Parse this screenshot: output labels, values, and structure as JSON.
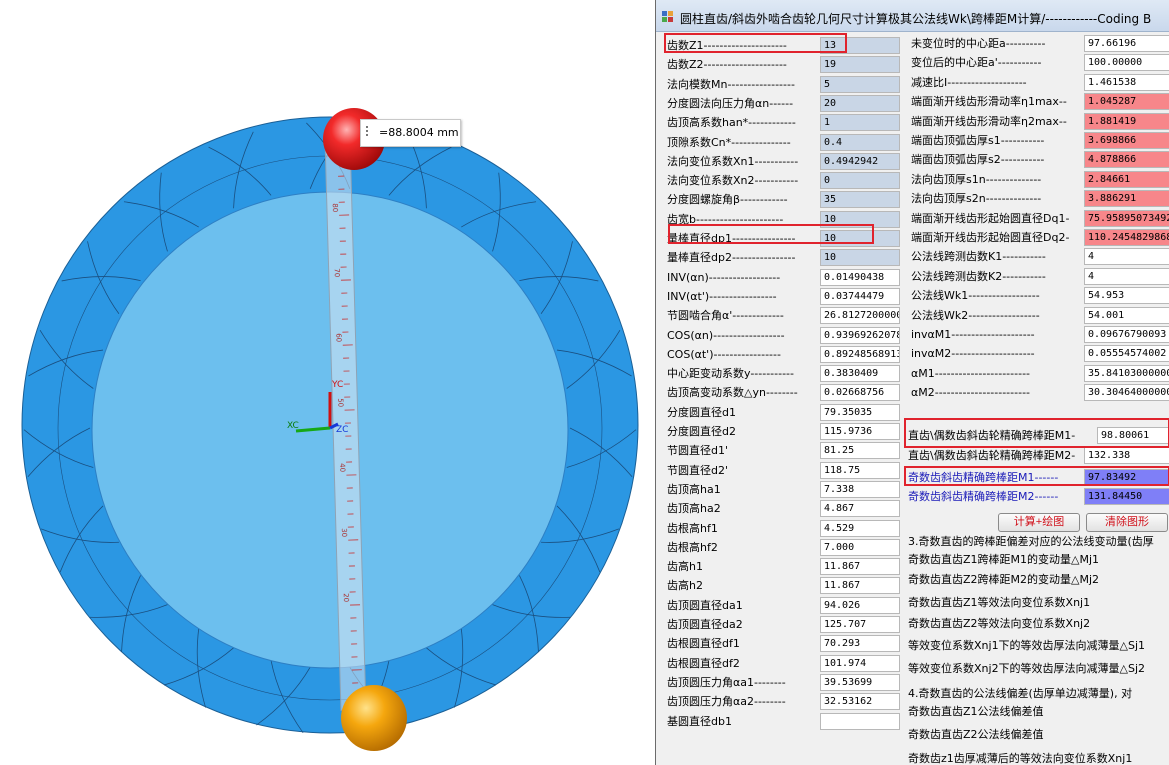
{
  "window": {
    "title": "圆柱直齿/斜齿外啮合齿轮几何尺寸计算极其公法线Wk\\跨棒距M计算/------------Coding B"
  },
  "viewport": {
    "measurement": "=88.8004 mm",
    "ruler_ticks": [
      "80",
      "70",
      "60",
      "50",
      "40",
      "30",
      "20"
    ],
    "axes": {
      "yc": "YC",
      "xc": "XC",
      "zc": "ZC"
    },
    "colors": {
      "gear_outer": "#2d9be7",
      "gear_inner": "#6cc0ee",
      "ball_top": "#e51b1b",
      "ball_bottom": "#f2a50c"
    }
  },
  "left_rows": [
    {
      "label": "齿数Z1---------------------",
      "value": "13",
      "kind": "in"
    },
    {
      "label": "齿数Z2---------------------",
      "value": "19",
      "kind": "in"
    },
    {
      "label": "法向模数Mn-----------------",
      "value": "5",
      "kind": "in"
    },
    {
      "label": "分度圆法向压力角αn------",
      "value": "20",
      "kind": "in"
    },
    {
      "label": "齿顶高系数han*------------",
      "value": "1",
      "kind": "in"
    },
    {
      "label": "顶隙系数Cn*---------------",
      "value": "0.4",
      "kind": "in"
    },
    {
      "label": "法向变位系数Xn1-----------",
      "value": "0.4942942",
      "kind": "in"
    },
    {
      "label": "法向变位系数Xn2-----------",
      "value": "0",
      "kind": "in"
    },
    {
      "label": "分度圆螺旋角β------------",
      "value": "35",
      "kind": "in"
    },
    {
      "label": "齿宽b----------------------",
      "value": "10",
      "kind": "in"
    },
    {
      "label": "量棒直径dp1----------------",
      "value": "10",
      "kind": "in"
    },
    {
      "label": "量棒直径dp2----------------",
      "value": "10",
      "kind": "in"
    },
    {
      "label": "INV(αn)------------------",
      "value": "0.01490438",
      "kind": "out"
    },
    {
      "label": "INV(αt')-----------------",
      "value": "0.03744479",
      "kind": "out"
    },
    {
      "label": "节圆啮合角α'-------------",
      "value": "26.81272000000",
      "kind": "out"
    },
    {
      "label": "COS(αn)------------------",
      "value": "0.93969262078",
      "kind": "out"
    },
    {
      "label": "COS(αt')-----------------",
      "value": "0.89248568913",
      "kind": "out"
    },
    {
      "label": "中心距变动系数y-----------",
      "value": "0.3830409",
      "kind": "out"
    },
    {
      "label": "齿顶高变动系数△yn--------",
      "value": "0.02668756",
      "kind": "out"
    },
    {
      "label": "分度圆直径d1",
      "value": "79.35035",
      "kind": "out"
    },
    {
      "label": "分度圆直径d2",
      "value": "115.9736",
      "kind": "out"
    },
    {
      "label": "节圆直径d1'",
      "value": "81.25",
      "kind": "out"
    },
    {
      "label": "节圆直径d2'",
      "value": "118.75",
      "kind": "out"
    },
    {
      "label": "齿顶高ha1",
      "value": "7.338",
      "kind": "out"
    },
    {
      "label": "齿顶高ha2",
      "value": "4.867",
      "kind": "out"
    },
    {
      "label": "齿根高hf1",
      "value": "4.529",
      "kind": "out"
    },
    {
      "label": "齿根高hf2",
      "value": "7.000",
      "kind": "out"
    },
    {
      "label": "齿高h1",
      "value": "11.867",
      "kind": "out"
    },
    {
      "label": "齿高h2",
      "value": "11.867",
      "kind": "out"
    },
    {
      "label": "齿顶圆直径da1",
      "value": "94.026",
      "kind": "out"
    },
    {
      "label": "齿顶圆直径da2",
      "value": "125.707",
      "kind": "out"
    },
    {
      "label": "齿根圆直径df1",
      "value": "70.293",
      "kind": "out"
    },
    {
      "label": "齿根圆直径df2",
      "value": "101.974",
      "kind": "out"
    },
    {
      "label": "齿顶圆压力角αa1--------",
      "value": "39.53699",
      "kind": "out"
    },
    {
      "label": "齿顶圆压力角αa2--------",
      "value": "32.53162",
      "kind": "out"
    },
    {
      "label": "基圆直径db1",
      "value": "",
      "kind": "out"
    }
  ],
  "right_rows": [
    {
      "label": "未变位时的中心距a----------",
      "value": "97.66196",
      "kind": "out"
    },
    {
      "label": "变位后的中心距a'-----------",
      "value": "100.00000",
      "kind": "out"
    },
    {
      "label": "减速比I--------------------",
      "value": "1.461538",
      "kind": "out"
    },
    {
      "label": "端面渐开线齿形滑动率η1max--",
      "value": "1.045287",
      "kind": "red"
    },
    {
      "label": "端面渐开线齿形滑动率η2max--",
      "value": "1.881419",
      "kind": "red"
    },
    {
      "label": "端面齿顶弧齿厚s1-----------",
      "value": "3.698866",
      "kind": "red"
    },
    {
      "label": "端面齿顶弧齿厚s2-----------",
      "value": "4.878866",
      "kind": "red"
    },
    {
      "label": "法向齿顶厚s1n--------------",
      "value": "2.84661",
      "kind": "red"
    },
    {
      "label": "法向齿顶厚s2n--------------",
      "value": "3.886291",
      "kind": "red"
    },
    {
      "label": "端面渐开线齿形起始圆直径Dq1-",
      "value": "75.95895073492",
      "kind": "red"
    },
    {
      "label": "端面渐开线齿形起始圆直径Dq2-",
      "value": "110.2454829868",
      "kind": "red"
    },
    {
      "label": "公法线跨测齿数K1-----------",
      "value": "4",
      "kind": "out"
    },
    {
      "label": "公法线跨测齿数K2-----------",
      "value": "4",
      "kind": "out"
    },
    {
      "label": "公法线Wk1------------------",
      "value": "54.953",
      "kind": "out"
    },
    {
      "label": "公法线Wk2------------------",
      "value": "54.001",
      "kind": "out"
    },
    {
      "label": "invαM1---------------------",
      "value": "0.09676790093",
      "kind": "out"
    },
    {
      "label": "invαM2---------------------",
      "value": "0.05554574002",
      "kind": "out"
    },
    {
      "label": "αM1------------------------",
      "value": "35.84103000000",
      "kind": "out"
    },
    {
      "label": "αM2------------------------",
      "value": "30.30464000000",
      "kind": "out"
    }
  ],
  "m_rows": [
    {
      "label": "直齿\\偶数齿斜齿轮精确跨棒距M1-",
      "value": "98.80061",
      "kind": "out"
    },
    {
      "label": "直齿\\偶数齿斜齿轮精确跨棒距M2-",
      "value": "132.338",
      "kind": "out"
    },
    {
      "label": "奇数齿斜齿精确跨棒距M1------",
      "value": "97.83492",
      "kind": "blue"
    },
    {
      "label": "奇数齿斜齿精确跨棒距M2------",
      "value": "131.84450",
      "kind": "blue"
    }
  ],
  "buttons": {
    "calc": "计算+绘图",
    "clear": "清除图形"
  },
  "section3": {
    "heading": "3.奇数直齿的跨棒距偏差对应的公法线变动量(齿厚",
    "lines": [
      "奇数齿直齿Z1跨棒距M1的变动量△Mj1",
      "奇数齿直齿Z2跨棒距M2的变动量△Mj2",
      "奇数齿直齿Z1等效法向变位系数Xnj1",
      "奇数齿直齿Z2等效法向变位系数Xnj2",
      "等效变位系数Xnj1下的等效齿厚法向减薄量△Sj1",
      "等效变位系数Xnj2下的等效齿厚法向减薄量△Sj2"
    ]
  },
  "section4": {
    "heading": "4.奇数直齿的公法线偏差(齿厚单边减薄量), 对",
    "lines": [
      "奇数齿直齿Z1公法线偏差值",
      "奇数齿直齿Z2公法线偏差值",
      "奇数齿z1齿厚减薄后的等效法向变位系数Xnj1"
    ]
  }
}
